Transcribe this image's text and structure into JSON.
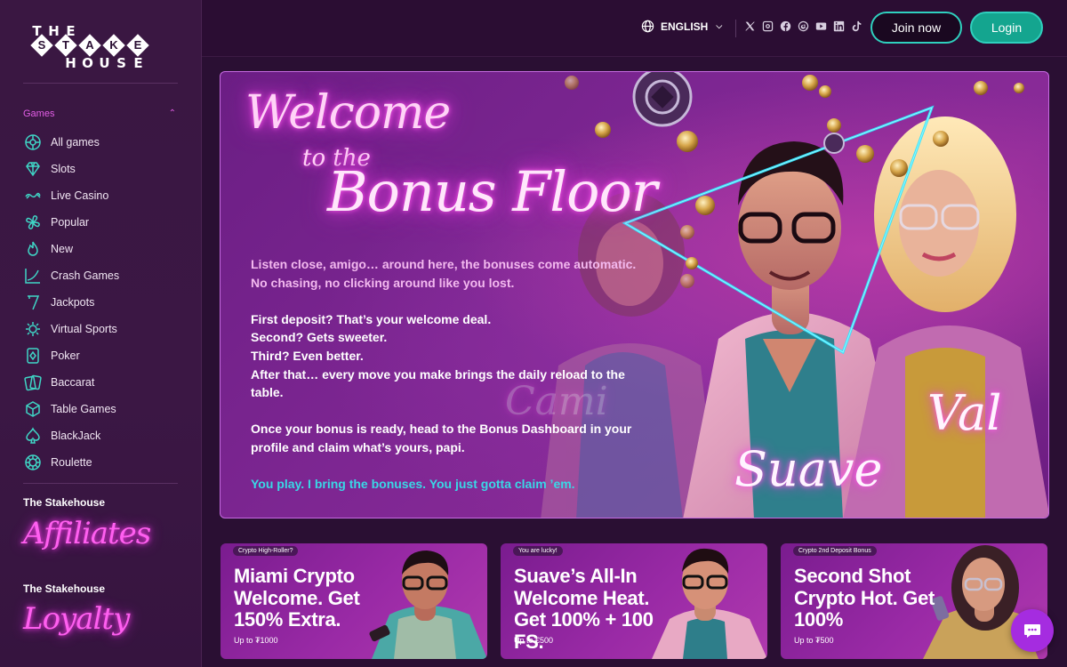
{
  "brand": {
    "logo_row1": [
      "T",
      "H",
      "E"
    ],
    "logo_row2": [
      "S",
      "T",
      "A",
      "K",
      "E"
    ],
    "logo_row3": [
      "H",
      "O",
      "U",
      "S",
      "E"
    ]
  },
  "sidebar": {
    "games_header": "Games",
    "items": [
      {
        "label": "All games",
        "icon": "all-games-icon"
      },
      {
        "label": "Slots",
        "icon": "diamond-icon"
      },
      {
        "label": "Live Casino",
        "icon": "live-casino-icon"
      },
      {
        "label": "Popular",
        "icon": "popular-icon"
      },
      {
        "label": "New",
        "icon": "flame-icon"
      },
      {
        "label": "Crash Games",
        "icon": "crash-chart-icon"
      },
      {
        "label": "Jackpots",
        "icon": "seven-icon"
      },
      {
        "label": "Virtual Sports",
        "icon": "virtual-sports-icon"
      },
      {
        "label": "Poker",
        "icon": "poker-card-icon"
      },
      {
        "label": "Baccarat",
        "icon": "cards-icon"
      },
      {
        "label": "Table Games",
        "icon": "dice-icon"
      },
      {
        "label": "BlackJack",
        "icon": "spade-icon"
      },
      {
        "label": "Roulette",
        "icon": "roulette-icon"
      }
    ],
    "affiliates_title": "The Stakehouse",
    "affiliates_script": "Affiliates",
    "loyalty_title": "The Stakehouse",
    "loyalty_script": "Loyalty"
  },
  "header": {
    "language": "ENGLISH",
    "socials": [
      "x-icon",
      "instagram-icon",
      "facebook-icon",
      "threads-icon",
      "youtube-icon",
      "linkedin-icon",
      "tiktok-icon"
    ],
    "join_label": "Join now",
    "login_label": "Login"
  },
  "hero": {
    "title_line1": "Welcome",
    "title_line2": "to the",
    "title_line3": "Bonus Floor",
    "paragraph1_line1": "Listen close, amigo… around here, the bonuses come automatic.",
    "paragraph1_line2": "No chasing, no clicking around like you lost.",
    "paragraph2_line1": "First deposit? That’s your welcome deal.",
    "paragraph2_line2": "Second? Gets sweeter.",
    "paragraph2_line3": "Third? Even better.",
    "paragraph2_line4": "After that… every move you make brings the daily reload to the table.",
    "paragraph3": "Once your bonus is ready, head to the Bonus Dashboard in your profile and claim what’s yours, papi.",
    "closing": "You play. I bring the bonuses. You just gotta claim ’em.",
    "signature_left": "Suave",
    "signature_right": "Val",
    "signature_faded": "Cami"
  },
  "promos": [
    {
      "tag": "Crypto High-Roller?",
      "headline": "Miami Crypto Welcome. Get 150% Extra.",
      "sub": "Up to ₮1000"
    },
    {
      "tag": "You are lucky!",
      "headline": "Suave’s All-In Welcome Heat. Get 100% + 100 FS.",
      "sub": "Up to €500"
    },
    {
      "tag": "Crypto 2nd Deposit Bonus",
      "headline": "Second Shot Crypto Hot. Get 100%",
      "sub": "Up to ₮500"
    }
  ],
  "colors": {
    "accent_teal": "#2fd0be",
    "neon_pink": "#ff5ff0",
    "background": "#2a0f33",
    "chat_purple": "#a52ce0"
  }
}
